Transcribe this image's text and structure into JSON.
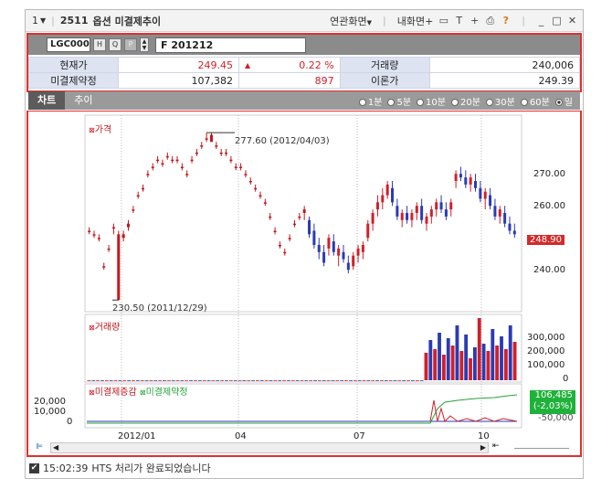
{
  "window": {
    "number": "1",
    "screen_no": "2511",
    "title": "옵션 미결제추이",
    "menu_related": "연관화면",
    "menu_my": "내화면+"
  },
  "badges": {
    "top": "1",
    "chart": "2"
  },
  "code": {
    "input_value": "LGC000",
    "btn_h": "H",
    "btn_search": "Q",
    "btn_p": "P",
    "futures_value": "F 201212"
  },
  "quote": {
    "current_label": "현재가",
    "current_value": "249.45",
    "change_arrow": "▲",
    "change_pct": "0.22 %",
    "volume_label": "거래량",
    "volume_value": "240,006",
    "oi_label": "미결제약정",
    "oi_value": "107,382",
    "oi_change": "897",
    "theory_label": "이론가",
    "theory_value": "249.39"
  },
  "tabs": [
    "차트",
    "추이"
  ],
  "periods": [
    {
      "label": "1분",
      "selected": false
    },
    {
      "label": "5분",
      "selected": false
    },
    {
      "label": "10분",
      "selected": false
    },
    {
      "label": "20분",
      "selected": false
    },
    {
      "label": "30분",
      "selected": false
    },
    {
      "label": "60분",
      "selected": false
    },
    {
      "label": "일",
      "selected": true
    }
  ],
  "chart_data": {
    "type": "candlestick",
    "price_panel": {
      "legend": "가격",
      "y_ticks": [
        "270.00",
        "260.00",
        "240.00"
      ],
      "ylim": [
        228,
        282
      ],
      "current_price_label": "248.90",
      "high_annotation": "277.60 (2012/04/03)",
      "low_annotation": "230.50 (2011/12/29)",
      "ohlc_sparse_before": "2012-07",
      "candles": [
        [
          250,
          251,
          249,
          250
        ],
        [
          249,
          250,
          248,
          249
        ],
        [
          248,
          249,
          247,
          248
        ],
        [
          240,
          241,
          239,
          240
        ],
        [
          245,
          246,
          244,
          245
        ],
        [
          251,
          252,
          249,
          251
        ],
        [
          230.5,
          250,
          230.5,
          249
        ],
        [
          249,
          250,
          247,
          248
        ],
        [
          251,
          253,
          250,
          252
        ],
        [
          256,
          257,
          255,
          256
        ],
        [
          260,
          261,
          259,
          260
        ],
        [
          262,
          263,
          261,
          262
        ],
        [
          266,
          267,
          265,
          266
        ],
        [
          268,
          269,
          267,
          268
        ],
        [
          270,
          271,
          269,
          270
        ],
        [
          269,
          270,
          268,
          269
        ],
        [
          271,
          272,
          270,
          271
        ],
        [
          270,
          271,
          269,
          270
        ],
        [
          270,
          271,
          269,
          270
        ],
        [
          268,
          269,
          267,
          268
        ],
        [
          266,
          267,
          265,
          266
        ],
        [
          270,
          271,
          269,
          270
        ],
        [
          272,
          273,
          271,
          272
        ],
        [
          274,
          275,
          273,
          274
        ],
        [
          276,
          277.6,
          275,
          276
        ],
        [
          277,
          277.6,
          275,
          275
        ],
        [
          274,
          275,
          273,
          274
        ],
        [
          272,
          273,
          271,
          272
        ],
        [
          272,
          273,
          271,
          272
        ],
        [
          270,
          271,
          269,
          270
        ],
        [
          268,
          269,
          267,
          268
        ],
        [
          268,
          269,
          267,
          268
        ],
        [
          266,
          267,
          265,
          266
        ],
        [
          264,
          265,
          263,
          264
        ],
        [
          262,
          263,
          261,
          262
        ],
        [
          260,
          261,
          259,
          260
        ],
        [
          258,
          259,
          257,
          258
        ],
        [
          254,
          255,
          253,
          254
        ],
        [
          250,
          251,
          249,
          250
        ],
        [
          246,
          247,
          245,
          246
        ],
        [
          244,
          245,
          243,
          244
        ],
        [
          248,
          249,
          247,
          248
        ],
        [
          252,
          253,
          251,
          252
        ],
        [
          254,
          255,
          253,
          254
        ],
        [
          256,
          257,
          253,
          255
        ],
        [
          253,
          254,
          248,
          249
        ],
        [
          250,
          252,
          245,
          246
        ],
        [
          246,
          248,
          242,
          244
        ],
        [
          244,
          246,
          240,
          241
        ],
        [
          245,
          249,
          243,
          248
        ],
        [
          247,
          249,
          243,
          244
        ],
        [
          243,
          246,
          240,
          245
        ],
        [
          244,
          246,
          241,
          242
        ],
        [
          241,
          243,
          238,
          239
        ],
        [
          240,
          244,
          239,
          243
        ],
        [
          243,
          246,
          241,
          245
        ],
        [
          244,
          247,
          242,
          246
        ],
        [
          248,
          253,
          247,
          252
        ],
        [
          252,
          256,
          250,
          255
        ],
        [
          256,
          260,
          254,
          258
        ],
        [
          258,
          262,
          256,
          260
        ],
        [
          260,
          264,
          259,
          263
        ],
        [
          262,
          264,
          257,
          258
        ],
        [
          257,
          259,
          253,
          254
        ],
        [
          253,
          256,
          251,
          255
        ],
        [
          255,
          257,
          252,
          253
        ],
        [
          253,
          256,
          251,
          255
        ],
        [
          255,
          258,
          253,
          257
        ],
        [
          257,
          259,
          252,
          253
        ],
        [
          252,
          255,
          250,
          254
        ],
        [
          254,
          257,
          252,
          256
        ],
        [
          256,
          259,
          254,
          258
        ],
        [
          258,
          260,
          255,
          256
        ],
        [
          256,
          258,
          253,
          254
        ],
        [
          256,
          259,
          254,
          258
        ],
        [
          264,
          267,
          262,
          266
        ],
        [
          266,
          268,
          264,
          265
        ],
        [
          265,
          267,
          262,
          263
        ],
        [
          263,
          266,
          261,
          265
        ],
        [
          264,
          266,
          261,
          262
        ],
        [
          262,
          264,
          258,
          259
        ],
        [
          259,
          262,
          256,
          261
        ],
        [
          260,
          262,
          256,
          257
        ],
        [
          257,
          259,
          253,
          254
        ],
        [
          254,
          257,
          252,
          256
        ],
        [
          255,
          257,
          251,
          252
        ],
        [
          252,
          254,
          249,
          250
        ],
        [
          250,
          252,
          248,
          249
        ]
      ]
    },
    "volume_panel": {
      "legend": "거래량",
      "y_ticks": [
        "300,000",
        "200,000",
        "100,000",
        "0"
      ],
      "ylim": [
        0,
        340000
      ],
      "values": [
        0,
        0,
        0,
        0,
        0,
        0,
        0,
        0,
        0,
        0,
        0,
        0,
        0,
        0,
        0,
        0,
        0,
        0,
        0,
        0,
        0,
        0,
        0,
        0,
        0,
        0,
        0,
        0,
        0,
        0,
        0,
        0,
        0,
        0,
        0,
        0,
        0,
        0,
        0,
        0,
        0,
        0,
        0,
        0,
        0,
        0,
        0,
        0,
        0,
        0,
        0,
        0,
        0,
        0,
        0,
        0,
        0,
        0,
        0,
        0,
        0,
        0,
        0,
        0,
        0,
        0,
        0,
        0,
        0,
        0,
        0,
        0,
        0,
        0,
        0,
        0,
        150000,
        220000,
        170000,
        260000,
        140000,
        230000,
        190000,
        300000,
        160000,
        250000,
        120000,
        180000,
        340000,
        200000,
        160000,
        280000,
        190000,
        240000,
        170000,
        300000,
        210000
      ]
    },
    "oi_panel": {
      "legend_change": "미결제증감",
      "legend_oi": "미결제약정",
      "y_ticks": [
        "20,000",
        "10,000",
        "0"
      ],
      "right_label_green_top": "106,485",
      "right_label_green_bottom": "(-2,03%)",
      "right_label_gray": "-50,000"
    },
    "x_ticks": [
      "2012/01",
      "04",
      "07",
      "10"
    ]
  },
  "status": {
    "time": "15:02:39",
    "message": "HTS 처리가 완료되었습니다"
  }
}
